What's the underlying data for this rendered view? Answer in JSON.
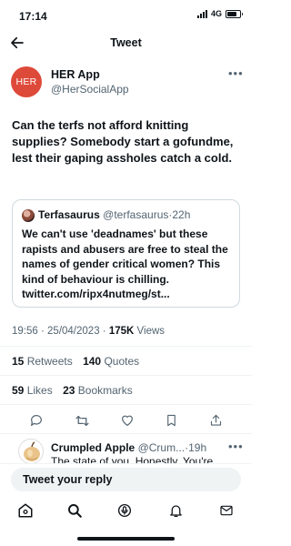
{
  "status_bar": {
    "time": "17:14",
    "network": "4G"
  },
  "header": {
    "title": "Tweet"
  },
  "author": {
    "avatar_text": "HER",
    "name": "HER App",
    "handle": "@HerSocialApp",
    "avatar_color": "#de4a3a"
  },
  "tweet": {
    "text": "Can the terfs not afford knitting supplies? Somebody start a gofundme, lest their gaping assholes catch a cold."
  },
  "quoted_tweet": {
    "name": "Terfasaurus",
    "handle": "@terfasaurus",
    "separator": "·",
    "age": "22h",
    "text": "We can't use 'deadnames' but these rapists and abusers are free to steal the names of gender critical women? This kind of behaviour is chilling. twitter.com/ripx4nutmeg/st..."
  },
  "meta": {
    "time": "19:56",
    "date": "25/04/2023",
    "separator": "·",
    "views_count": "175K",
    "views_label": "Views"
  },
  "engagement": {
    "retweets_count": "15",
    "retweets_label": "Retweets",
    "quotes_count": "140",
    "quotes_label": "Quotes",
    "likes_count": "59",
    "likes_label": "Likes",
    "bookmarks_count": "23",
    "bookmarks_label": "Bookmarks"
  },
  "actions": [
    "reply-icon",
    "retweet-icon",
    "like-icon",
    "bookmark-icon",
    "share-icon"
  ],
  "reply": {
    "name": "Crumpled Apple",
    "handle": "@Crum...",
    "separator": "·",
    "age": "19h",
    "text": "The state of you. Honestly. You're"
  },
  "compose": {
    "placeholder": "Tweet your reply"
  },
  "bottom_nav": [
    "home-icon",
    "search-icon",
    "spaces-icon",
    "notifications-icon",
    "messages-icon"
  ],
  "colors": {
    "text": "#0f1419",
    "secondary": "#536471",
    "border": "#cfd9de",
    "background": "#ffffff"
  }
}
